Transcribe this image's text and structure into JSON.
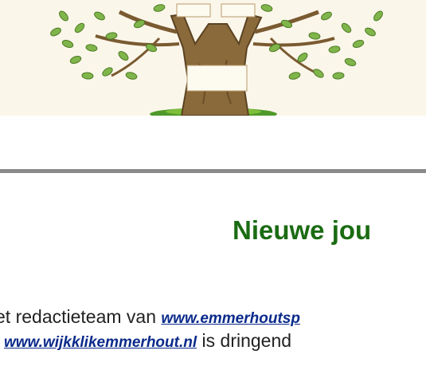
{
  "banner": {
    "image": "family-tree-illustration"
  },
  "heading": {
    "text": "Nieuwe jou"
  },
  "paragraph": {
    "line1_prefix": "et redactieteam van ",
    "link1": "www.emmerhoutsp",
    "link2": "www.wijkklikemmerhout.nl",
    "line2_suffix": " is dringend"
  },
  "colors": {
    "heading": "#1a6b12",
    "link": "#0a2a8a",
    "rule": "#8a8a8a"
  }
}
